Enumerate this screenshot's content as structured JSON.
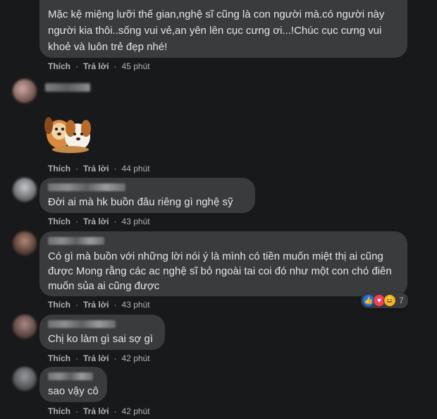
{
  "comments": [
    {
      "text": "Mặc kệ miệng lưỡi thế gian,nghệ sĩ cũng là con người mà.có người này người kia thôi..sống vui vẻ,an yên lên cục cưng ơi...!Chúc cục cưng vui khoẻ và luôn trẻ đẹp nhé!",
      "like": "Thích",
      "reply": "Trả lời",
      "time": "45 phút"
    },
    {
      "sticker": "dog-hug-sticker",
      "like": "Thích",
      "reply": "Trả lời",
      "time": "44 phút"
    },
    {
      "text": "Đời ai mà hk buồn đâu riêng gì nghệ sỹ",
      "like": "Thích",
      "reply": "Trả lời",
      "time": "43 phút"
    },
    {
      "text": "Có gì mà buồn với những lời nói ý là mình có tiền muốn miệt thị ai cũng được Mong rằng các ac nghệ sĩ bỏ ngoài tai coi đó như một con chó điên muốn sủa ai cũng được",
      "like": "Thích",
      "reply": "Trả lời",
      "time": "43 phút",
      "reaction_count": "7"
    },
    {
      "text": "Chị ko làm gì sai sợ gì",
      "like": "Thích",
      "reply": "Trả lời",
      "time": "42 phút"
    },
    {
      "text": "sao vậy cô",
      "like": "Thích",
      "reply": "Trả lời",
      "time": "42 phút"
    }
  ],
  "colors": {
    "background": "#18191a",
    "bubble": "#3a3b3c",
    "text": "#e4e6eb",
    "meta": "#b0b3b8"
  },
  "icons": [
    "like-reaction-icon",
    "love-reaction-icon",
    "haha-reaction-icon"
  ]
}
